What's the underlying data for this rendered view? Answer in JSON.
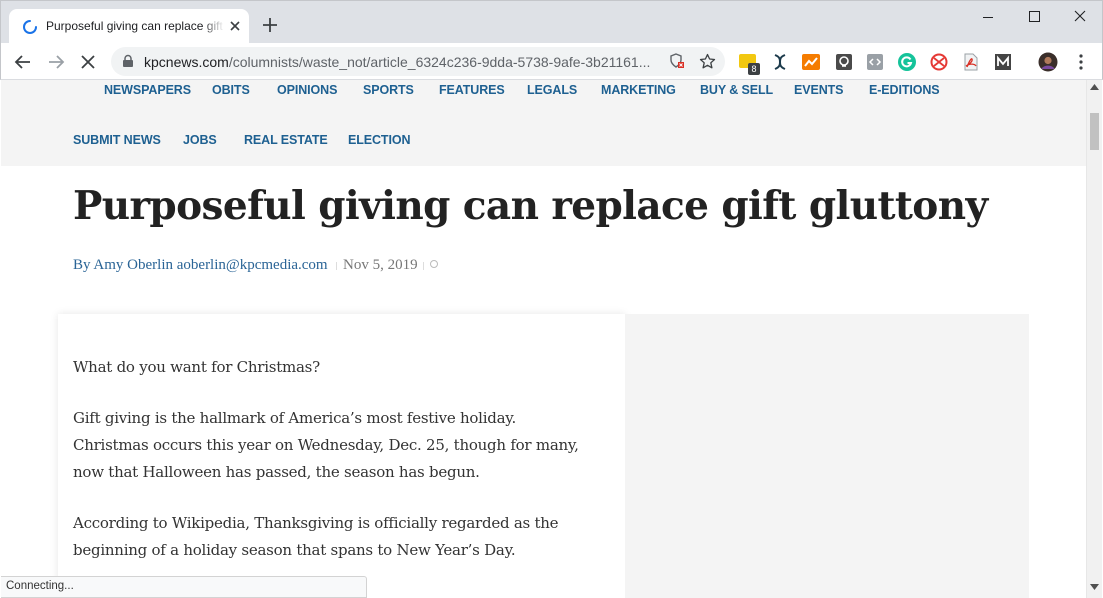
{
  "browser": {
    "tab_title": "Purposeful giving can replace gift gluttony",
    "url_host": "kpcnews.com",
    "url_path": "/columnists/waste_not/article_6324c236-9dda-5738-9afe-3b21161...",
    "extension_badge": "8",
    "status_text": "Connecting..."
  },
  "nav": {
    "row1": [
      "NEWSPAPERS",
      "OBITS",
      "OPINIONS",
      "SPORTS",
      "FEATURES",
      "LEGALS",
      "MARKETING",
      "BUY & SELL",
      "EVENTS",
      "E-EDITIONS"
    ],
    "row2": [
      "SUBMIT NEWS",
      "JOBS",
      "REAL ESTATE",
      "ELECTION"
    ]
  },
  "article": {
    "headline": "Purposeful giving can replace gift gluttony",
    "byline": "By Amy Oberlin aoberlin@kpcmedia.com",
    "date": "Nov 5, 2019",
    "comment_count": "0",
    "paragraphs": [
      "What do you want for Christmas?",
      "Gift giving is the hallmark of America’s most festive holiday. Christmas occurs this year on Wednesday, Dec. 25, though for many, now that Halloween has passed, the season has begun.",
      "According to Wikipedia, Thanksgiving is officially regarded as the beginning of a holiday season that spans to New Year’s Day."
    ]
  },
  "colors": {
    "nav_link": "#1e6091",
    "byline": "#2a6496",
    "titlebar": "#dee1e6"
  }
}
